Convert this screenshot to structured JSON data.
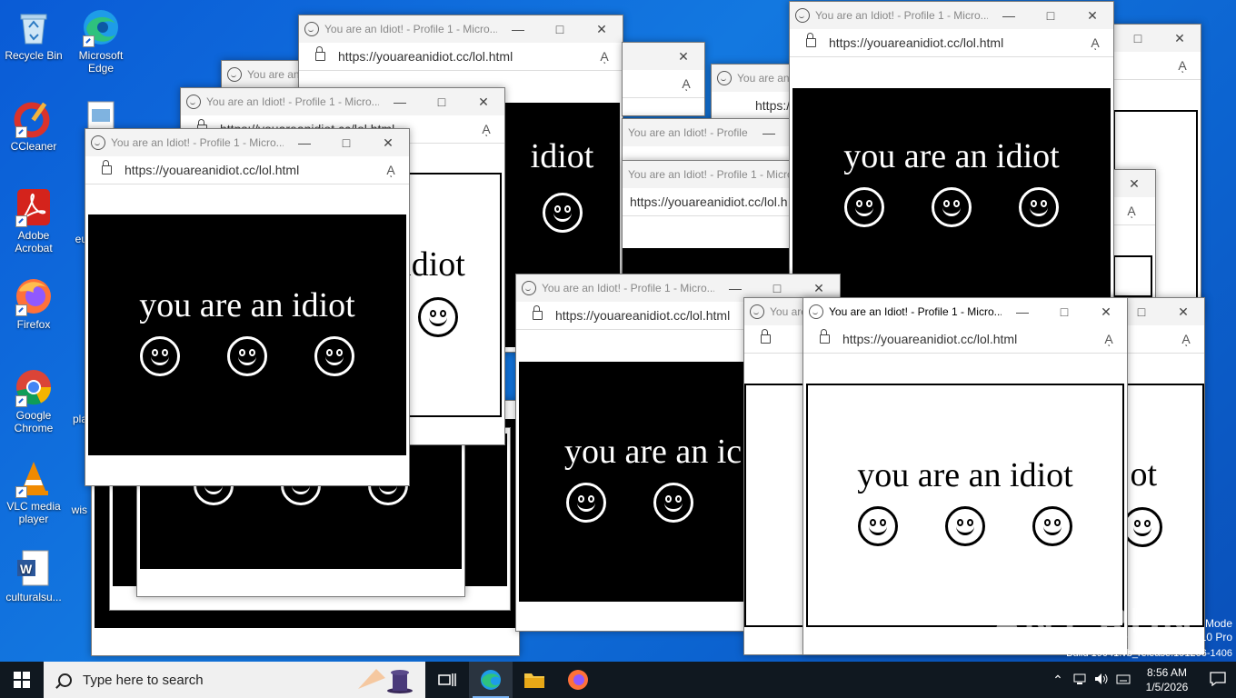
{
  "desktop": {
    "icons": [
      {
        "label": "Recycle Bin"
      },
      {
        "label": "Microsoft Edge"
      },
      {
        "label": "CCleaner"
      },
      {
        "label": "ea"
      },
      {
        "label": "Adobe Acrobat"
      },
      {
        "label": "eu"
      },
      {
        "label": "Firefox"
      },
      {
        "label": "Google Chrome"
      },
      {
        "label": "pla"
      },
      {
        "label": "VLC media player"
      },
      {
        "label": "wis"
      },
      {
        "label": "culturalsu..."
      }
    ]
  },
  "browser": {
    "title": "You are an Idiot! - Profile 1 - Micro...",
    "title_short": "You are an",
    "url": "https://youareanidiot.cc/lol.html",
    "url_short": "https://youareanidiot.cc/lol.h",
    "read_aloud": "Aͅ",
    "minimize": "—",
    "maximize": "□",
    "close": "✕",
    "message": "you are an idiot",
    "message_partial_1": "idiot",
    "message_partial_2": "iot",
    "message_partial_3": "you are an ic",
    "message_partial_4": "ot"
  },
  "taskbar": {
    "search_placeholder": "Type here to search",
    "time": "8:56 AM",
    "date": "1/5/2026"
  },
  "watermark": {
    "text": "ANY RUN",
    "mode_line1": "Mode",
    "mode_line2": "10 Pro",
    "build": "Build 19041.vb_release.191206-1406"
  }
}
